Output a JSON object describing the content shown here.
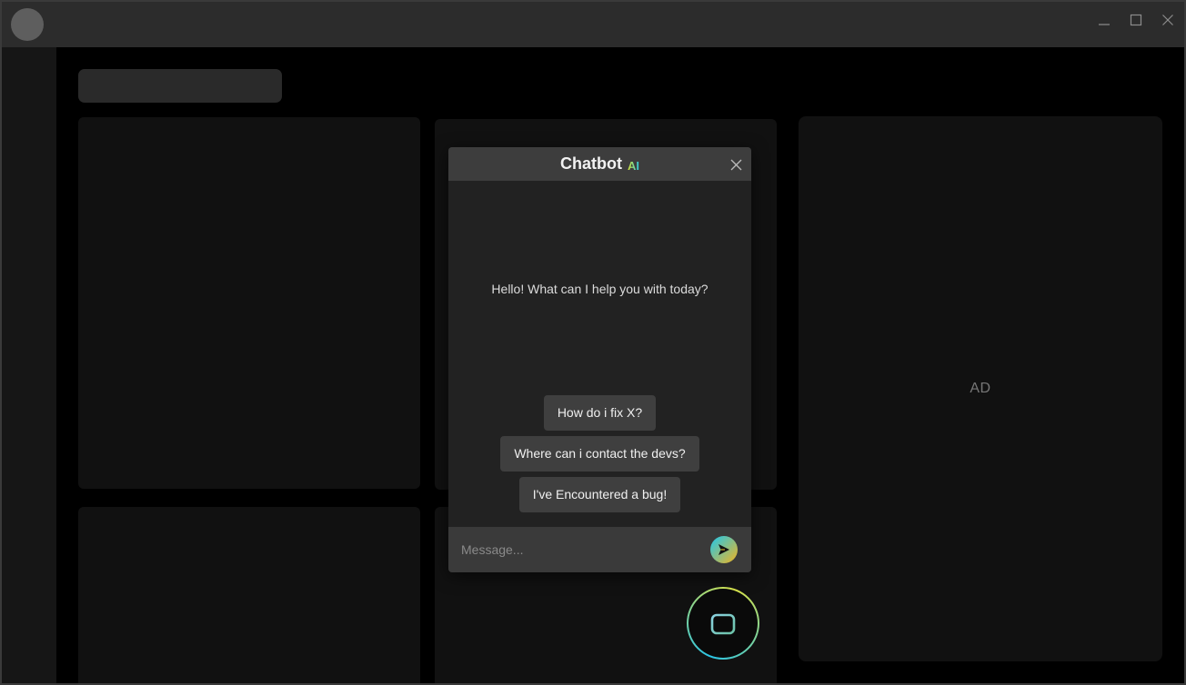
{
  "window": {
    "controls": [
      {
        "name": "minimize",
        "icon": "minimize-icon"
      },
      {
        "name": "maximize",
        "icon": "maximize-icon"
      },
      {
        "name": "close",
        "icon": "close-icon"
      }
    ]
  },
  "ad": {
    "label": "AD"
  },
  "chat": {
    "title": "Chatbot",
    "badge": "AI",
    "greeting": "Hello! What can I help you with today?",
    "suggestions": [
      "How do i fix X?",
      "Where can i contact the devs?",
      "I've Encountered a bug!"
    ],
    "input": {
      "placeholder": "Message...",
      "value": ""
    },
    "send_icon": "send-icon",
    "close_icon": "close-icon"
  },
  "fab": {
    "icon": "robot-icon"
  },
  "colors": {
    "accent_cyan": "#27c7e4",
    "accent_yellow": "#d7e233",
    "panel": "#222222",
    "header": "#3d3d3d",
    "chip": "#3f3f3f"
  }
}
